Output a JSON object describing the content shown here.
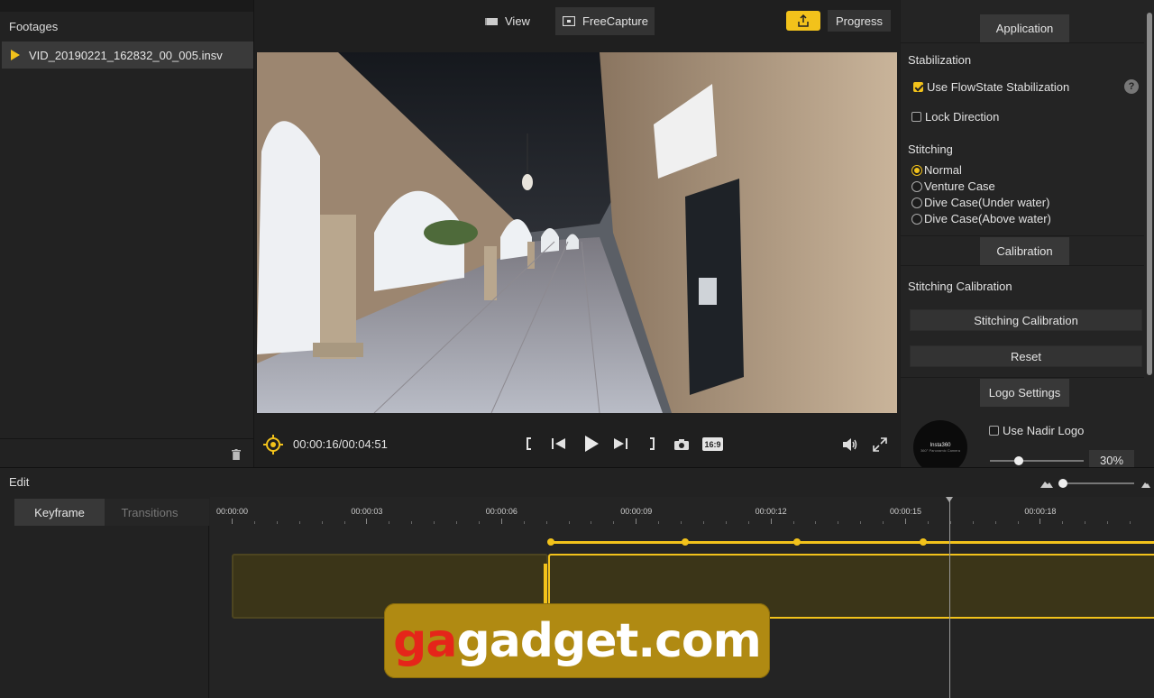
{
  "footages": {
    "header": "Footages",
    "items": [
      {
        "name": "VID_20190221_162832_00_005.insv"
      }
    ]
  },
  "toolbar": {
    "view_label": "View",
    "freecapture_label": "FreeCapture",
    "progress_label": "Progress"
  },
  "player": {
    "time": "00:00:16/00:04:51",
    "aspect_label": "16:9"
  },
  "right_panel": {
    "application_tab": "Application",
    "stabilization_label": "Stabilization",
    "flowstate_label": "Use FlowState Stabilization",
    "flowstate_checked": true,
    "help_label": "?",
    "lock_direction_label": "Lock Direction",
    "lock_direction_checked": false,
    "stitching_label": "Stitching",
    "stitching_options": [
      "Normal",
      "Venture Case",
      "Dive Case(Under water)",
      "Dive Case(Above water)"
    ],
    "stitching_selected": "Normal",
    "calibration_tab": "Calibration",
    "stitching_calibration_label": "Stitching Calibration",
    "stitching_calibration_button": "Stitching Calibration",
    "reset_button": "Reset",
    "logo_settings_tab": "Logo Settings",
    "nadir_logo_label": "Use Nadir Logo",
    "nadir_logo_checked": false,
    "logo_brand": "Insta360",
    "logo_sub": "360° Panoramic Camera",
    "logo_size": "30%",
    "logo_size_value": 0.3
  },
  "edit": {
    "header": "Edit",
    "tabs": [
      "Keyframe",
      "Transitions"
    ],
    "active_tab": "Keyframe",
    "timeline_ticks": [
      "00:00:00",
      "00:00:03",
      "00:00:06",
      "00:00:09",
      "00:00:12",
      "00:00:15",
      "00:00:18"
    ],
    "keyframes_sec": [
      7.1,
      10.1,
      12.6,
      15.4
    ]
  },
  "watermark": {
    "part1": "ga",
    "part2": "gadget.com"
  },
  "colors": {
    "accent": "#f2c21b",
    "panel": "#242424",
    "button": "#383838"
  }
}
